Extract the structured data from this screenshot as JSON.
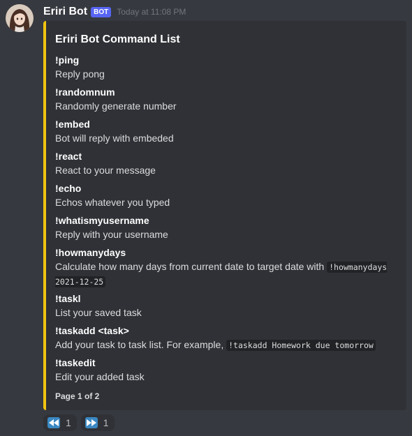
{
  "author": {
    "name": "Eriri Bot",
    "tag": "BOT",
    "timestamp": "Today at 11:08 PM"
  },
  "embed": {
    "accent_color": "#f1c40f",
    "title": "Eriri Bot Command List",
    "fields": [
      {
        "name": "!ping",
        "value": "Reply pong"
      },
      {
        "name": "!randomnum",
        "value": "Randomly generate number"
      },
      {
        "name": "!embed",
        "value": "Bot will reply with embeded"
      },
      {
        "name": "!react",
        "value": "React to your message"
      },
      {
        "name": "!echo",
        "value": "Echos whatever you typed"
      },
      {
        "name": "!whatismyusername",
        "value": "Reply with your username"
      },
      {
        "name": "!howmanydays",
        "value": "Calculate how many days from current date to target date with ",
        "code": "!howmanydays 2021-12-25"
      },
      {
        "name": "!taskl",
        "value": "List your saved task"
      },
      {
        "name": "!taskadd <task>",
        "value": "Add your task to task list. For example, ",
        "code": "!taskadd Homework due tomorrow"
      },
      {
        "name": "!taskedit",
        "value": "Edit your added task"
      }
    ],
    "footer": "Page 1 of 2"
  },
  "reactions": [
    {
      "icon": "rewind-icon",
      "count": "1"
    },
    {
      "icon": "fast-forward-icon",
      "count": "1"
    }
  ]
}
